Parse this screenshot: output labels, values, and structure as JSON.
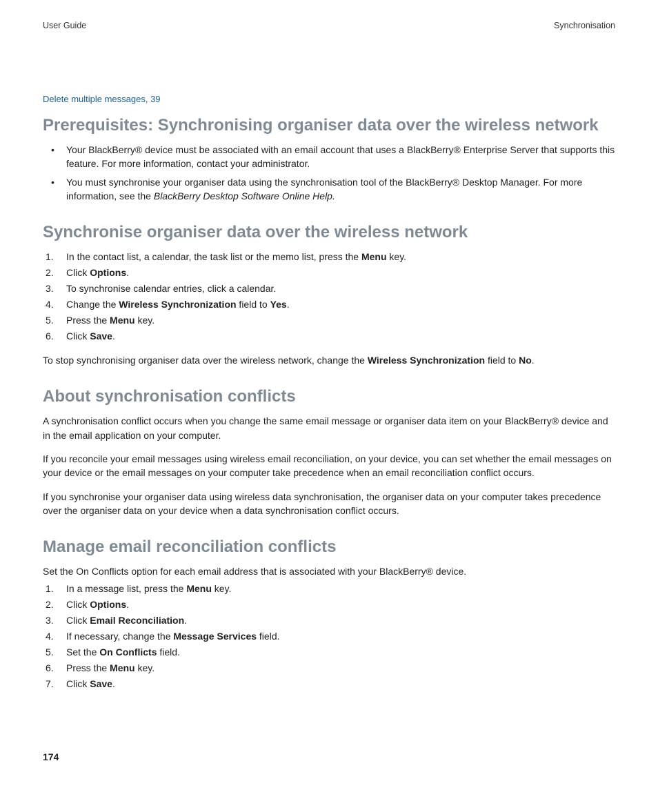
{
  "header": {
    "left": "User Guide",
    "right": "Synchronisation"
  },
  "crossref": "Delete multiple messages, 39",
  "page_number": "174",
  "sections": [
    {
      "title": "Prerequisites: Synchronising organiser data over the wireless network",
      "bullets": [
        {
          "a": "Your BlackBerry® device must be associated with an email account that uses a BlackBerry® Enterprise Server that supports this feature. For more information, contact your administrator.",
          "b": ""
        },
        {
          "a": "You must synchronise your organiser data using the synchronisation tool of the BlackBerry® Desktop Manager. For more information, see the  ",
          "b": "BlackBerry Desktop Software Online Help."
        }
      ]
    },
    {
      "title": "Synchronise organiser data over the wireless network",
      "steps": [
        {
          "a": "In the contact list, a calendar, the task list or the memo list, press the ",
          "b": "Menu",
          "c": " key."
        },
        {
          "a": "Click ",
          "b": "Options",
          "c": "."
        },
        {
          "a": "To synchronise calendar entries, click a calendar."
        },
        {
          "a": "Change the ",
          "b": "Wireless Synchronization",
          "c": " field to ",
          "d": "Yes",
          "e": "."
        },
        {
          "a": "Press the ",
          "b": "Menu",
          "c": " key."
        },
        {
          "a": "Click ",
          "b": "Save",
          "c": "."
        }
      ],
      "note": {
        "a": "To stop synchronising organiser data over the wireless network, change the ",
        "b": "Wireless Synchronization",
        "c": " field to ",
        "d": "No",
        "e": "."
      }
    },
    {
      "title": "About synchronisation conflicts",
      "paras": [
        "A synchronisation conflict occurs when you change the same email message or organiser data item on your BlackBerry® device and in the email application on your computer.",
        "If you reconcile your email messages using wireless email reconciliation, on your device, you can set whether the email messages on your device or the email messages on your computer take precedence when an email reconciliation conflict occurs.",
        "If you synchronise your organiser data using wireless data synchronisation, the organiser data on your computer takes precedence over the organiser data on your device when a data synchronisation conflict occurs."
      ]
    },
    {
      "title": "Manage email reconciliation conflicts",
      "intro": "Set the On Conflicts option for each email address that is associated with your BlackBerry® device.",
      "steps": [
        {
          "a": "In a message list, press the ",
          "b": "Menu",
          "c": " key."
        },
        {
          "a": "Click ",
          "b": "Options",
          "c": "."
        },
        {
          "a": "Click ",
          "b": "Email Reconciliation",
          "c": "."
        },
        {
          "a": "If necessary, change the ",
          "b": "Message Services",
          "c": " field."
        },
        {
          "a": "Set the ",
          "b": "On Conflicts",
          "c": " field."
        },
        {
          "a": "Press the ",
          "b": "Menu",
          "c": " key."
        },
        {
          "a": "Click ",
          "b": "Save",
          "c": "."
        }
      ]
    }
  ]
}
